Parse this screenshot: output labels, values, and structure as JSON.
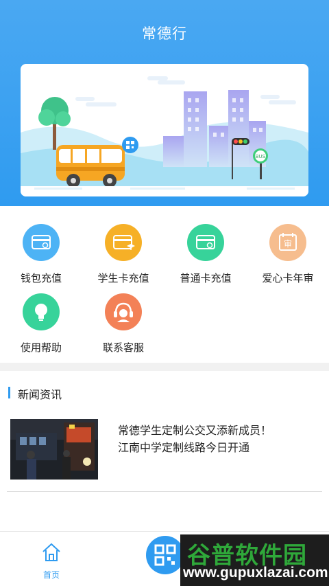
{
  "header": {
    "title": "常德行"
  },
  "banner": {
    "bus_sign": "BUS"
  },
  "services": [
    {
      "label": "钱包充值",
      "icon": "wallet-card-icon",
      "color": "#4db3f5"
    },
    {
      "label": "学生卡充值",
      "icon": "student-card-icon",
      "color": "#f6b027"
    },
    {
      "label": "普通卡充值",
      "icon": "regular-card-icon",
      "color": "#37d39a"
    },
    {
      "label": "爱心卡年审",
      "icon": "annual-review-icon",
      "color": "#f6bd8e",
      "icon_text": "审"
    },
    {
      "label": "使用帮助",
      "icon": "lightbulb-icon",
      "color": "#37d39a"
    },
    {
      "label": "联系客服",
      "icon": "customer-service-icon",
      "color": "#f38157"
    }
  ],
  "news": {
    "section_title": "新闻资讯",
    "items": [
      {
        "line1": "常德学生定制公交又添新成员！",
        "line2": "江南中学定制线路今日开通"
      }
    ]
  },
  "tabbar": {
    "home_label": "首页",
    "scan": "qr-scan-icon"
  },
  "watermark": {
    "title": "谷普软件园",
    "url": "www.gupuxlazai.com"
  },
  "colors": {
    "primary": "#2f9bf0",
    "watermark_green": "#2fa83a"
  }
}
